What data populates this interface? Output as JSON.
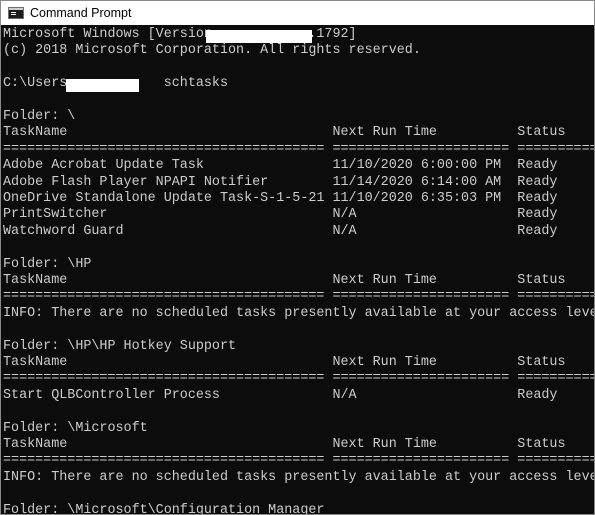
{
  "window": {
    "title": "Command Prompt",
    "icon": "terminal-icon"
  },
  "console": {
    "lines": [
      "Microsoft Windows [Version            .1792]",
      "(c) 2018 Microsoft Corporation. All rights reserved.",
      "",
      "C:\\Users            schtasks",
      "",
      "Folder: \\",
      "TaskName                                 Next Run Time          Status",
      "======================================== ====================== ===============",
      "Adobe Acrobat Update Task                11/10/2020 6:00:00 PM  Ready",
      "Adobe Flash Player NPAPI Notifier        11/14/2020 6:14:00 AM  Ready",
      "OneDrive Standalone Update Task-S-1-5-21 11/10/2020 6:35:03 PM  Ready",
      "PrintSwitcher                            N/A                    Ready",
      "Watchword Guard                          N/A                    Ready",
      "",
      "Folder: \\HP",
      "TaskName                                 Next Run Time          Status",
      "======================================== ====================== ===============",
      "INFO: There are no scheduled tasks presently available at your access level.",
      "",
      "Folder: \\HP\\HP Hotkey Support",
      "TaskName                                 Next Run Time          Status",
      "======================================== ====================== ===============",
      "Start QLBController Process              N/A                    Ready",
      "",
      "Folder: \\Microsoft",
      "TaskName                                 Next Run Time          Status",
      "======================================== ====================== ===============",
      "INFO: There are no scheduled tasks presently available at your access level.",
      "",
      "Folder: \\Microsoft\\Configuration Manager"
    ]
  }
}
